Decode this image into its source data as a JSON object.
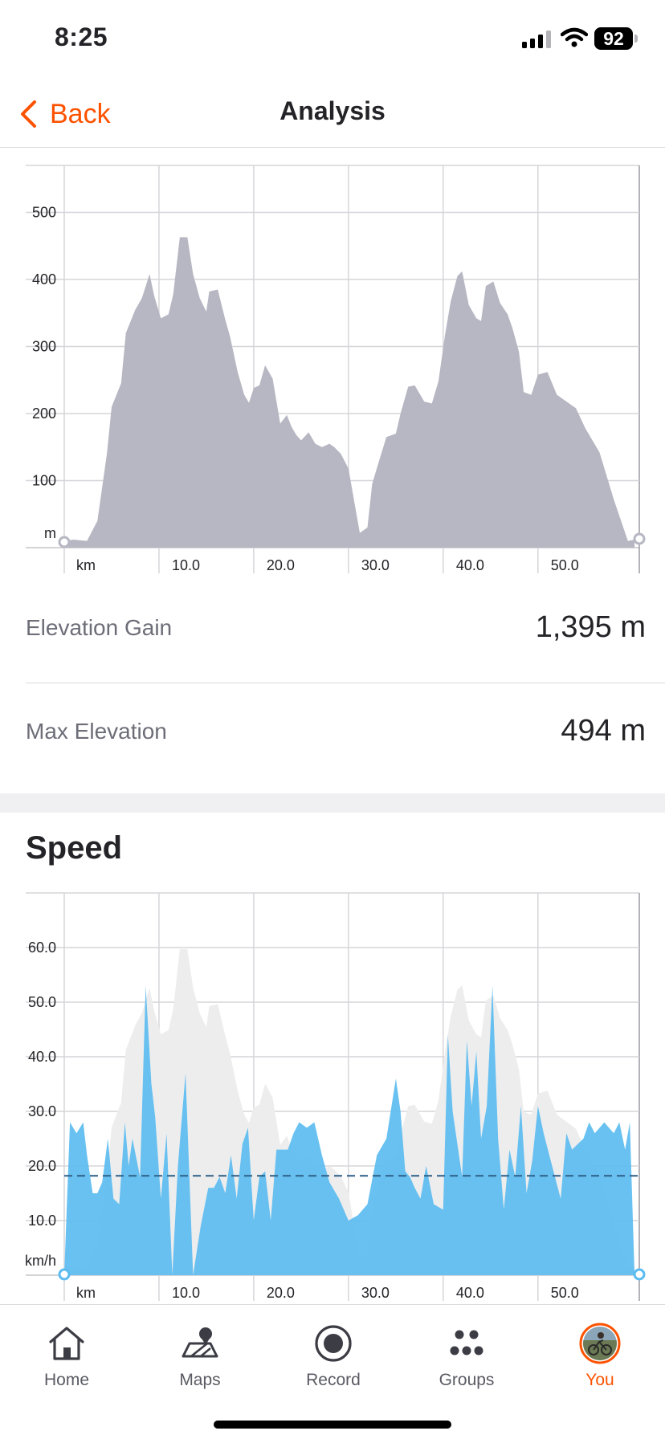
{
  "status_bar": {
    "time": "8:25",
    "battery": "92"
  },
  "nav": {
    "back_label": "Back",
    "title": "Analysis"
  },
  "colors": {
    "accent": "#fc5200",
    "elevation_fill": "#b7b7c3",
    "speed_fill": "#5bbcf0",
    "speed_dash": "#2d5f86",
    "ghost_fill": "#ededee"
  },
  "elevation_chart": {
    "chart_data": {
      "type": "area",
      "title": "",
      "xlabel": "km",
      "ylabel": "m",
      "xlim": [
        0,
        60.7
      ],
      "ylim": [
        0,
        570
      ],
      "x_ticks": [
        "10.0",
        "20.0",
        "30.0",
        "40.0",
        "50.0"
      ],
      "y_ticks": [
        "100",
        "200",
        "300",
        "400",
        "500"
      ],
      "grid": true,
      "series": [
        {
          "x": [
            0,
            1.0,
            2.4,
            3.5,
            4.5,
            5.0,
            6.0,
            6.5,
            7.5,
            8.2,
            9.0,
            9.5,
            10.2,
            11.0,
            11.5,
            12.2,
            13.0,
            13.6,
            14.3,
            15.0,
            15.3,
            16.2,
            17.0,
            17.5,
            18.3,
            19.0,
            19.5,
            20.0,
            20.6,
            21.2,
            22.0,
            22.8,
            23.5,
            24.0,
            24.5,
            25.0,
            25.8,
            26.5,
            27.2,
            28.0,
            28.5,
            29.2,
            30.0,
            30.6,
            31.2,
            32.0,
            32.5,
            33.2,
            34.0,
            35.0,
            35.5,
            36.3,
            37.0,
            38.0,
            38.8,
            39.5,
            40.2,
            40.8,
            41.5,
            42.0,
            42.7,
            43.5,
            44.0,
            44.5,
            45.3,
            46.0,
            46.8,
            47.3,
            48.0,
            48.5,
            49.3,
            50.0,
            51.0,
            52.0,
            53.0,
            54.0,
            55.0,
            56.5,
            58.0,
            59.5,
            60.2
          ],
          "values": [
            10,
            12,
            10,
            40,
            140,
            210,
            245,
            320,
            355,
            372,
            408,
            375,
            342,
            348,
            378,
            463,
            463,
            408,
            372,
            352,
            382,
            385,
            340,
            315,
            262,
            228,
            216,
            238,
            242,
            272,
            252,
            185,
            198,
            180,
            168,
            160,
            172,
            155,
            150,
            155,
            150,
            140,
            118,
            70,
            22,
            30,
            95,
            128,
            165,
            170,
            200,
            240,
            242,
            218,
            215,
            248,
            318,
            368,
            405,
            412,
            362,
            342,
            338,
            390,
            397,
            365,
            348,
            328,
            292,
            232,
            228,
            258,
            262,
            228,
            218,
            208,
            178,
            142,
            72,
            10,
            12,
            10,
            15,
            12,
            10,
            10,
            8
          ]
        }
      ]
    }
  },
  "stats": [
    {
      "label": "Elevation Gain",
      "value": "1,395 m"
    },
    {
      "label": "Max Elevation",
      "value": "494 m"
    }
  ],
  "speed_section": {
    "title": "Speed"
  },
  "speed_chart": {
    "chart_data": {
      "type": "area",
      "title": "",
      "xlabel": "km",
      "ylabel": "km/h",
      "xlim": [
        0,
        60.7
      ],
      "ylim": [
        0,
        70
      ],
      "x_ticks": [
        "10.0",
        "20.0",
        "30.0",
        "40.0",
        "50.0"
      ],
      "y_ticks": [
        "10.0",
        "20.0",
        "30.0",
        "40.0",
        "50.0",
        "60.0"
      ],
      "grid": true,
      "average_speed": 18.2,
      "series": [
        {
          "x": [
            0,
            0.6,
            1.3,
            2.0,
            2.4,
            3.0,
            3.5,
            4.0,
            4.6,
            5.2,
            5.8,
            6.4,
            6.8,
            7.2,
            8.0,
            8.6,
            9.2,
            9.6,
            10.2,
            10.8,
            11.4,
            12.0,
            12.8,
            13.6,
            14.4,
            15.2,
            15.8,
            16.4,
            17.0,
            17.6,
            18.2,
            18.8,
            19.4,
            20.0,
            20.6,
            21.2,
            21.8,
            22.4,
            23.0,
            23.6,
            24.2,
            24.8,
            25.6,
            26.4,
            27.2,
            28.0,
            29.0,
            30.0,
            31.0,
            32.0,
            33.0,
            34.0,
            35.0,
            35.5,
            36.0,
            36.5,
            37.0,
            37.6,
            38.2,
            39.0,
            40.0,
            40.5,
            41.0,
            42.0,
            42.5,
            43.0,
            43.5,
            44.0,
            44.6,
            45.2,
            45.8,
            46.4,
            47.0,
            47.6,
            48.2,
            48.8,
            49.4,
            50.0,
            50.6,
            51.2,
            51.8,
            52.4,
            53.0,
            53.6,
            54.2,
            54.8,
            55.4,
            56.0,
            57.0,
            58.0,
            58.6,
            59.2,
            59.7,
            60.2
          ],
          "values": [
            0,
            28,
            26,
            28,
            22,
            15,
            15,
            17,
            25,
            14,
            13,
            28,
            20,
            25,
            18,
            53,
            35,
            29,
            14,
            26,
            0,
            20,
            37,
            0,
            9,
            16,
            16,
            18,
            15,
            22,
            14,
            24,
            27,
            10,
            18,
            19,
            10,
            23,
            23,
            23,
            26,
            28,
            27,
            28,
            22,
            17,
            14,
            10,
            11,
            13,
            22,
            25,
            36,
            30,
            19,
            18,
            16,
            14,
            20,
            13,
            12,
            44,
            30,
            18,
            43,
            31,
            41,
            25,
            31,
            53,
            25,
            12,
            23,
            18,
            31,
            15,
            21,
            31,
            26,
            22,
            18,
            14,
            26,
            23,
            24,
            25,
            28,
            26,
            28,
            26,
            28,
            23,
            28,
            0
          ]
        }
      ]
    }
  },
  "tab_bar": {
    "tabs": [
      {
        "label": "Home",
        "icon": "home-icon"
      },
      {
        "label": "Maps",
        "icon": "maps-icon"
      },
      {
        "label": "Record",
        "icon": "record-icon"
      },
      {
        "label": "Groups",
        "icon": "groups-icon"
      },
      {
        "label": "You",
        "icon": "avatar",
        "active": true
      }
    ]
  }
}
